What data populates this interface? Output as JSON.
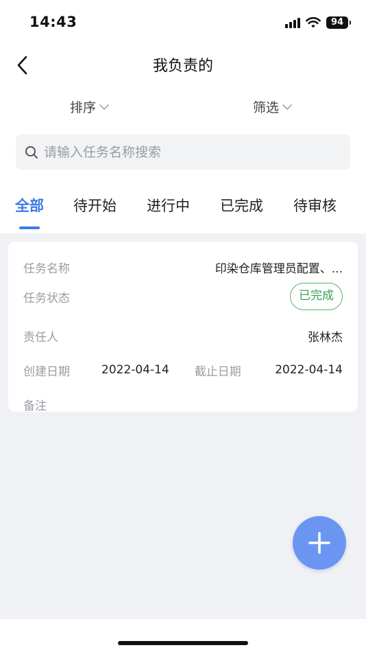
{
  "status_bar": {
    "time": "14:43",
    "battery": "94"
  },
  "nav": {
    "title": "我负责的"
  },
  "toolbar": {
    "sort_label": "排序",
    "filter_label": "筛选"
  },
  "search": {
    "placeholder": "请输入任务名称搜索",
    "value": ""
  },
  "tabs": [
    {
      "label": "全部",
      "active": true
    },
    {
      "label": "待开始"
    },
    {
      "label": "进行中"
    },
    {
      "label": "已完成"
    },
    {
      "label": "待审核"
    }
  ],
  "task_card": {
    "name_label": "任务名称",
    "name_value": "印染仓库管理员配置、...",
    "status_label": "任务状态",
    "status_value": "已完成",
    "owner_label": "责任人",
    "owner_value": "张林杰",
    "created_label": "创建日期",
    "created_value": "2022-04-14",
    "deadline_label": "截止日期",
    "deadline_value": "2022-04-14",
    "note_label": "备注",
    "note_value": ""
  },
  "colors": {
    "accent": "#3d7ae8",
    "fab": "#6a96f2",
    "status_done": "#3a9f55",
    "background": "#f0f1f4"
  }
}
